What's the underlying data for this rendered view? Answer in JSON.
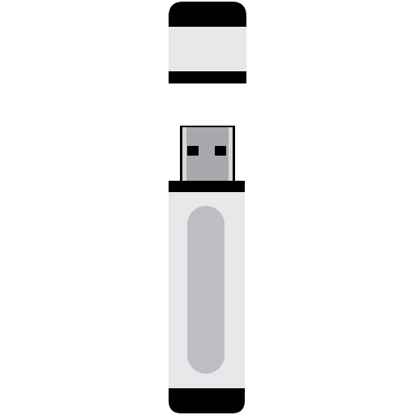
{
  "illustration": {
    "subject": "usb-flash-drive",
    "icon": "usb-flash-drive-icon",
    "parts": [
      "cap",
      "usb-connector",
      "drive-body",
      "grip-panel"
    ],
    "colors": {
      "background": "#ffffff",
      "outline": "#000000",
      "casing": "#e6e8ea",
      "grip": "#bdbdc3",
      "connector_metal": "#a9a9ad",
      "connector_highlight": "#d8d8dc",
      "connector_pin": "#000000"
    }
  }
}
